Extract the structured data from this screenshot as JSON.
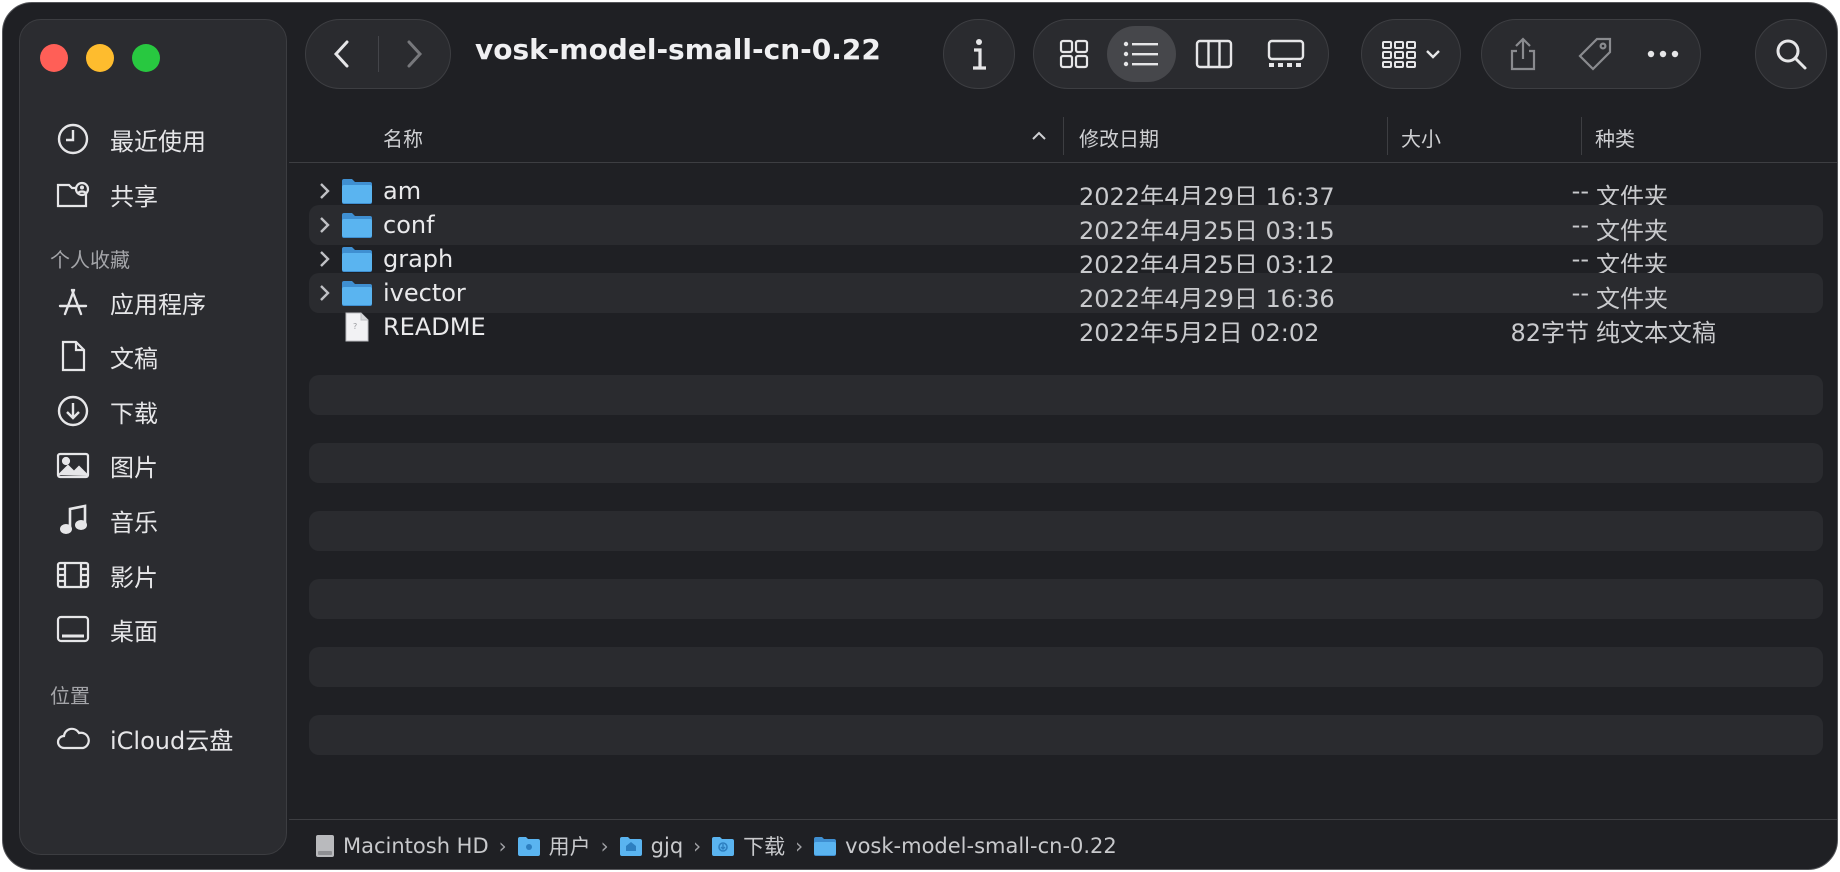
{
  "window": {
    "title": "vosk-model-small-cn-0.22"
  },
  "sidebar": {
    "items_top": [
      {
        "label": "最近使用",
        "icon": "clock-icon"
      },
      {
        "label": "共享",
        "icon": "shared-folder-icon"
      }
    ],
    "section_favorites": "个人收藏",
    "favorites": [
      {
        "label": "应用程序",
        "icon": "applications-icon"
      },
      {
        "label": "文稿",
        "icon": "document-icon"
      },
      {
        "label": "下载",
        "icon": "download-icon"
      },
      {
        "label": "图片",
        "icon": "pictures-icon"
      },
      {
        "label": "音乐",
        "icon": "music-icon"
      },
      {
        "label": "影片",
        "icon": "film-icon"
      },
      {
        "label": "桌面",
        "icon": "desktop-icon"
      }
    ],
    "section_locations": "位置",
    "locations": [
      {
        "label": "iCloud云盘",
        "icon": "cloud-icon"
      }
    ]
  },
  "columns": {
    "name": "名称",
    "date": "修改日期",
    "size": "大小",
    "kind": "种类"
  },
  "files": [
    {
      "name": "am",
      "date": "2022年4月29日 16:37",
      "size": "--",
      "kind": "文件夹",
      "type": "folder"
    },
    {
      "name": "conf",
      "date": "2022年4月25日 03:15",
      "size": "--",
      "kind": "文件夹",
      "type": "folder"
    },
    {
      "name": "graph",
      "date": "2022年4月25日 03:12",
      "size": "--",
      "kind": "文件夹",
      "type": "folder"
    },
    {
      "name": "ivector",
      "date": "2022年4月29日 16:36",
      "size": "--",
      "kind": "文件夹",
      "type": "folder"
    },
    {
      "name": "README",
      "date": "2022年5月2日 02:02",
      "size": "82字节",
      "kind": "纯文本文稿",
      "type": "file"
    }
  ],
  "pathbar": [
    {
      "label": "Macintosh HD",
      "icon": "hard-drive-icon"
    },
    {
      "label": "用户",
      "icon": "users-folder-icon"
    },
    {
      "label": "gjq",
      "icon": "home-folder-icon"
    },
    {
      "label": "下载",
      "icon": "downloads-folder-icon"
    },
    {
      "label": "vosk-model-small-cn-0.22",
      "icon": "folder-icon"
    }
  ],
  "colors": {
    "window_bg": "#1f2024",
    "sidebar_bg": "#2b2c30",
    "folder_blue": "#5ab4f0",
    "close": "#ff5f57",
    "minimize": "#febc2e",
    "maximize": "#28c840"
  }
}
